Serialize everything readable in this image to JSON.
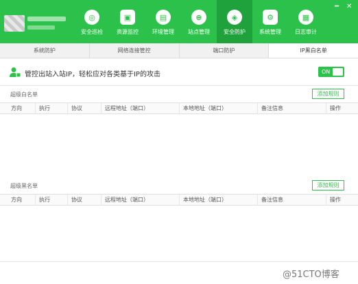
{
  "header": {
    "nav": [
      {
        "label": "安全巡检",
        "icon": "shield-scan-icon",
        "glyph": "◎"
      },
      {
        "label": "资源监控",
        "icon": "monitor-icon",
        "glyph": "▣"
      },
      {
        "label": "环境管理",
        "icon": "environment-icon",
        "glyph": "▤"
      },
      {
        "label": "站点管理",
        "icon": "globe-icon",
        "glyph": "⊕"
      },
      {
        "label": "安全防护",
        "icon": "shield-icon",
        "glyph": "◈"
      },
      {
        "label": "系统管理",
        "icon": "system-icon",
        "glyph": "⚙"
      },
      {
        "label": "日志审计",
        "icon": "log-icon",
        "glyph": "▦"
      }
    ],
    "active_index": 4,
    "minimize": "━",
    "close": "✕"
  },
  "tabs": [
    "系统防护",
    "网络连接管控",
    "端口防护",
    "IP黑白名单"
  ],
  "active_tab": 3,
  "banner": {
    "text": "管控出站入站IP，轻松应对各类基于IP的攻击",
    "toggle_label": "ON"
  },
  "whitelist": {
    "title": "超级白名单",
    "add_label": "添加规则"
  },
  "blacklist": {
    "title": "超级黑名单",
    "add_label": "添加规则"
  },
  "columns": [
    "方向",
    "执行",
    "协议",
    "远程地址（端口）",
    "本地地址（端口）",
    "备注信息",
    "操作"
  ],
  "watermark": "@51CTO博客",
  "colors": {
    "brand": "#2cc14a",
    "brand_dark": "#1fa23b"
  }
}
